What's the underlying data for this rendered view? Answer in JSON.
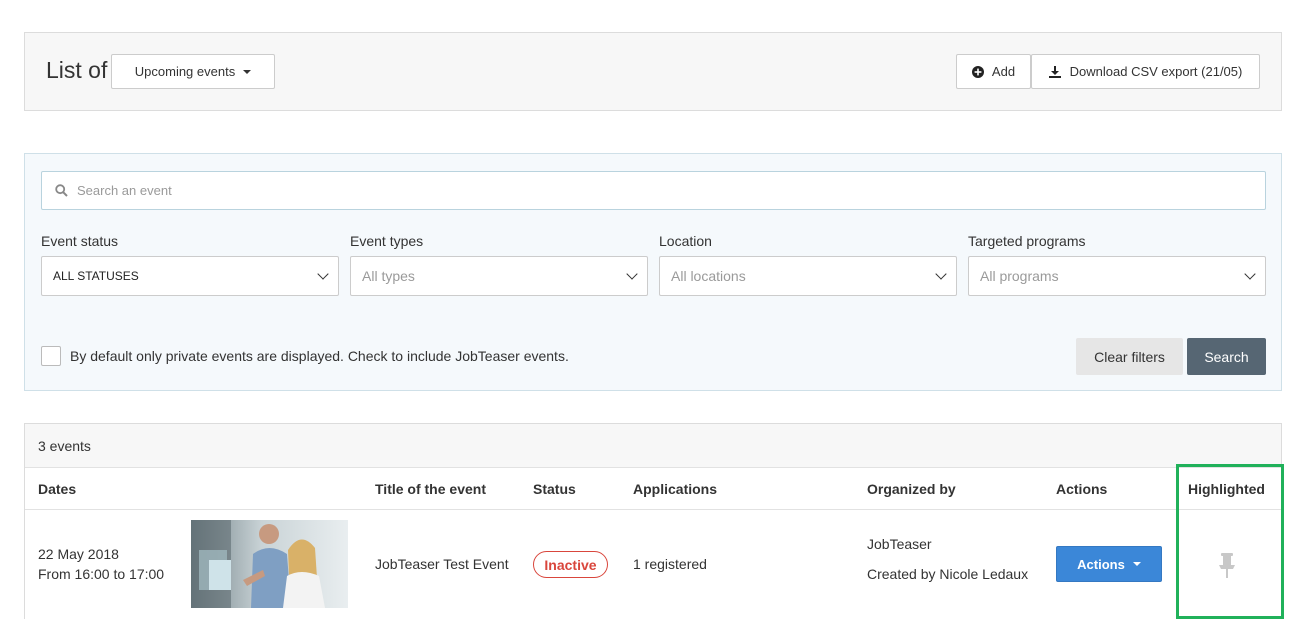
{
  "header": {
    "list_of": "List of",
    "view_select": "Upcoming events",
    "add_label": "Add",
    "csv_label": "Download CSV export (21/05)"
  },
  "filters": {
    "search_placeholder": "Search an event",
    "event_status": {
      "label": "Event status",
      "value": "ALL STATUSES"
    },
    "event_types": {
      "label": "Event types",
      "value": "All types"
    },
    "location": {
      "label": "Location",
      "value": "All locations"
    },
    "targeted_programs": {
      "label": "Targeted programs",
      "value": "All programs"
    },
    "checkbox_text": "By default only private events are displayed. Check to include JobTeaser events.",
    "clear_label": "Clear filters",
    "search_label": "Search"
  },
  "results": {
    "count": "3 events",
    "columns": [
      "Dates",
      "Title of the event",
      "Status",
      "Applications",
      "Organized by",
      "Actions",
      "Highlighted"
    ],
    "rows": [
      {
        "date": "22 May 2018",
        "time": "From 16:00 to 17:00",
        "title": "JobTeaser Test Event",
        "status": "Inactive",
        "applications": "1 registered",
        "organizer": "JobTeaser",
        "created_by": "Created by Nicole Ledaux",
        "actions_label": "Actions"
      }
    ]
  },
  "colors": {
    "highlight_border": "#20b15a",
    "primary_button": "#3b87d8",
    "search_button": "#566673",
    "inactive_badge": "#d9463c"
  },
  "icons": [
    "caret-down-icon",
    "plus-circle-icon",
    "download-icon",
    "search-icon",
    "chevron-down-icon",
    "pin-icon"
  ]
}
